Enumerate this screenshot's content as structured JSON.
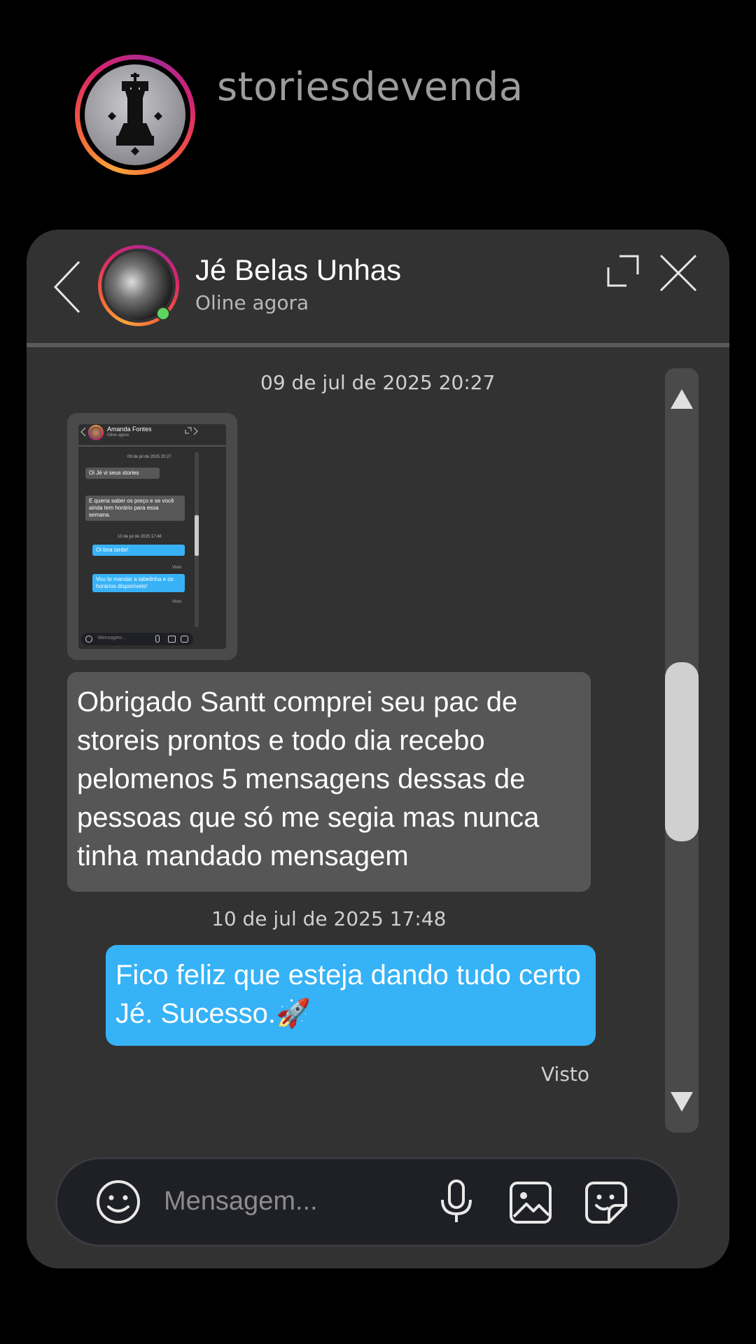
{
  "profile": {
    "username": "storiesdevenda",
    "avatar_icon": "chess-king-icon"
  },
  "chat": {
    "contact_name": "Jé Belas Unhas",
    "contact_status": "Oline agora",
    "online": true,
    "messages": [
      {
        "type": "timestamp",
        "text": "09 de jul de 2025 20:27"
      },
      {
        "type": "image",
        "from": "contact",
        "screenshot": {
          "contact_name": "Amanda Fontes",
          "contact_status": "Oline agora",
          "timestamp_1": "09 de jul de 2025 20:27",
          "msg_1": "Oi Jé vi seus stories",
          "msg_2": "E queria saber os preço e se você ainda tem horário para essa semana.",
          "timestamp_2": "10 de jul de 2025 17:48",
          "reply_1": "Oi boa tarde!",
          "seen_1": "Visto",
          "reply_2": "Vou te mandar a tabelinha e os horários disponíveis!",
          "seen_2": "Visto",
          "input_placeholder": "Mensagem..."
        }
      },
      {
        "type": "text",
        "from": "contact",
        "text": "Obrigado Santt comprei seu pac de storeis prontos e todo dia recebo pelomenos 5  mensagens dessas de pessoas que só me segia mas nunca tinha mandado mensagem"
      },
      {
        "type": "timestamp",
        "text": "10 de jul de 2025 17:48"
      },
      {
        "type": "text",
        "from": "me",
        "text": "Fico feliz que esteja dando tudo certo Jé. Sucesso.🚀"
      }
    ],
    "seen_label": "Visto"
  },
  "composer": {
    "placeholder": "Mensagem..."
  },
  "colors": {
    "background": "#000000",
    "panel": "#323232",
    "incoming_bubble": "#565656",
    "outgoing_bubble": "#36b2f6",
    "online": "#5ed35e"
  }
}
